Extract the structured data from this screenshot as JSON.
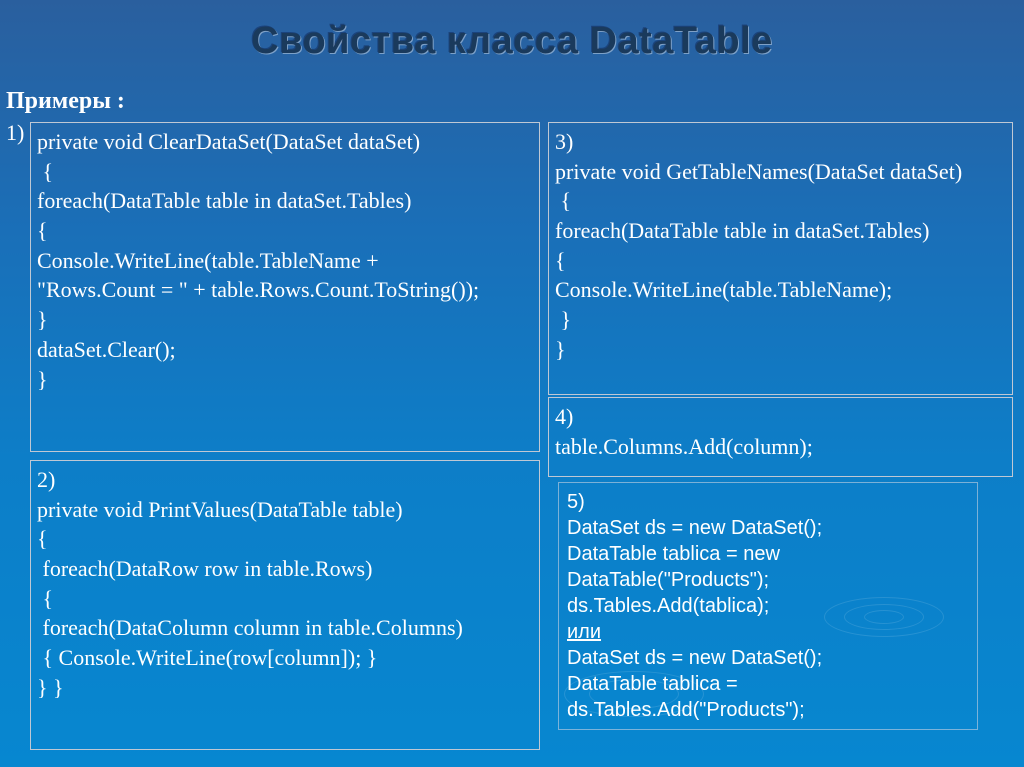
{
  "title": "Свойства класса DataTable",
  "subtitle": "Примеры :",
  "labels": {
    "n1": "1)"
  },
  "examples": {
    "e1": "private void ClearDataSet(DataSet dataSet)\n {\nforeach(DataTable table in dataSet.Tables)\n{\nConsole.WriteLine(table.TableName +\n\"Rows.Count = \" + table.Rows.Count.ToString());\n}\ndataSet.Clear();\n}",
    "e2": "2)\nprivate void PrintValues(DataTable table)\n{\n foreach(DataRow row in table.Rows)\n {\n foreach(DataColumn column in table.Columns)\n { Console.WriteLine(row[column]); }\n} }",
    "e3": "3)\nprivate void GetTableNames(DataSet dataSet)\n {\nforeach(DataTable table in dataSet.Tables)\n{\nConsole.WriteLine(table.TableName);\n }\n}",
    "e4": "4)\ntable.Columns.Add(column);",
    "e5a": "5)\nDataSet ds = new DataSet();\nDataTable tablica = new DataTable(\"Products\");\nds.Tables.Add(tablica);",
    "e5or": "или",
    "e5b": "DataSet ds = new DataSet();\nDataTable tablica = ds.Tables.Add(\"Products\");"
  }
}
